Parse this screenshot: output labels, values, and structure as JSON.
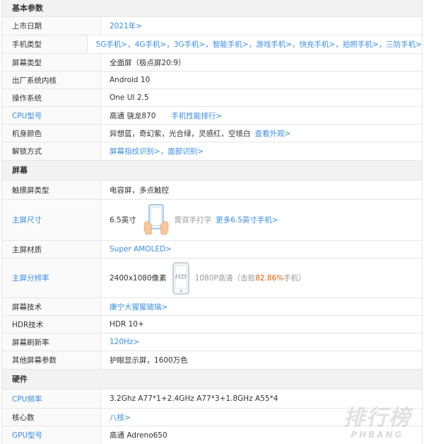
{
  "sections": {
    "basic": "基本参数",
    "screen": "屏幕",
    "hardware": "硬件"
  },
  "rows": {
    "launch_date": {
      "label": "上市日期",
      "value": "2021年>"
    },
    "phone_type": {
      "label": "手机类型",
      "items": [
        "5G手机>",
        "4G手机>",
        "3G手机>",
        "智能手机>",
        "游戏手机>",
        "快充手机>",
        "拍照手机>",
        "三防手机>"
      ],
      "sep": "，"
    },
    "screen_type": {
      "label": "屏幕类型",
      "value": "全面屏（极点屏20:9）"
    },
    "factory_os": {
      "label": "出厂系统内核",
      "value": "Android 10"
    },
    "os": {
      "label": "操作系统",
      "value": "One UI 2.5"
    },
    "cpu_model": {
      "label": "CPU型号",
      "value": "高通 骁龙870",
      "link": "手机性能排行>"
    },
    "body_color": {
      "label": "机身颜色",
      "value": "异想蓝，奇幻紫，光合绿，灵感红，空境白",
      "link": "查看外观>"
    },
    "unlock": {
      "label": "解锁方式",
      "items": [
        "屏幕指纹识别>",
        "面部识别>"
      ],
      "sep": "，"
    },
    "touch_type": {
      "label": "触摸屏类型",
      "value": "电容屏，多点触控"
    },
    "screen_size": {
      "label": "主屏尺寸",
      "value": "6.5英寸",
      "note": "需双手打字",
      "link": "更多6.5英寸手机>"
    },
    "screen_material": {
      "label": "主屏材质",
      "value": "Super AMOLED>"
    },
    "resolution": {
      "label": "主屏分辨率",
      "value": "2400x1080像素",
      "note_prefix": "1080P高清（击败",
      "percent": "82.86%",
      "note_suffix": "手机）",
      "badge": "HD"
    },
    "screen_tech": {
      "label": "屏幕技术",
      "value": "康宁大猩猩玻璃>"
    },
    "hdr": {
      "label": "HDR技术",
      "value": "HDR 10+"
    },
    "refresh": {
      "label": "屏幕刷新率",
      "value": "120Hz>"
    },
    "other_screen": {
      "label": "其他屏幕参数",
      "value": "护眼显示屏，1600万色"
    },
    "cpu_freq": {
      "label": "CPU频率",
      "value": "3.2Ghz A77*1+2.4GHz A77*3+1.8GHz A55*4"
    },
    "cores": {
      "label": "核心数",
      "value": "八核>"
    },
    "gpu": {
      "label": "GPU型号",
      "value": "高通 Adreno650"
    }
  },
  "watermark": {
    "main": "排行榜",
    "sub": "PHBANG"
  },
  "colors": {
    "link": "#3a8ee6",
    "highlight": "#e8590c",
    "section_bg": "#f2f2f2",
    "border": "#e6e6e6"
  }
}
